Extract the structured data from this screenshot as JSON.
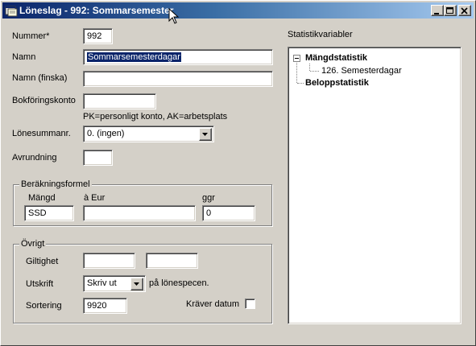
{
  "window": {
    "title": "Löneslag - 992: Sommarsemester"
  },
  "form": {
    "nummer_label": "Nummer*",
    "nummer_value": "992",
    "namn_label": "Namn",
    "namn_value": "Sommarsemesterdagar",
    "namn_finska_label": "Namn (finska)",
    "namn_finska_value": "",
    "bokforingskonto_label": "Bokföringskonto",
    "bokforingskonto_value": "",
    "bokforingskonto_hint": "PK=personligt konto, AK=arbetsplats",
    "lonesumman_label": "Lönesummanr.",
    "lonesumman_value": "0. (ingen)",
    "avrundning_label": "Avrundning",
    "avrundning_value": ""
  },
  "berakningsformel": {
    "title": "Beräkningsformel",
    "mangd_label": "Mängd",
    "mangd_value": "SSD",
    "a_eur_label": "à Eur",
    "a_eur_value": "",
    "ggr_label": "ggr",
    "ggr_value": "0"
  },
  "ovrigt": {
    "title": "Övrigt",
    "giltighet_label": "Giltighet",
    "giltighet_from": "",
    "giltighet_to": "",
    "utskrift_label": "Utskrift",
    "utskrift_value": "Skriv ut",
    "utskrift_suffix": "på lönespecen.",
    "sortering_label": "Sortering",
    "sortering_value": "9920",
    "kraver_datum_label": "Kräver datum",
    "kraver_datum_checked": false
  },
  "statistik": {
    "label": "Statistikvariabler",
    "tree": [
      {
        "label": "Mängdstatistik",
        "expanded": true,
        "children": [
          "126. Semesterdagar"
        ]
      },
      {
        "label": "Beloppstatistik",
        "expanded": false,
        "children": []
      }
    ]
  },
  "icons": {
    "app": "app-window-icon",
    "minimize": "minimize-icon",
    "maximize": "maximize-icon",
    "close": "close-icon",
    "dropdown": "chevron-down-icon",
    "tree_collapse": "tree-collapse-icon",
    "cursor": "mouse-pointer-icon"
  },
  "colors": {
    "titlebar_start": "#0a246a",
    "titlebar_end": "#a6caf0",
    "face": "#d4d0c8",
    "selection": "#0a246a"
  }
}
